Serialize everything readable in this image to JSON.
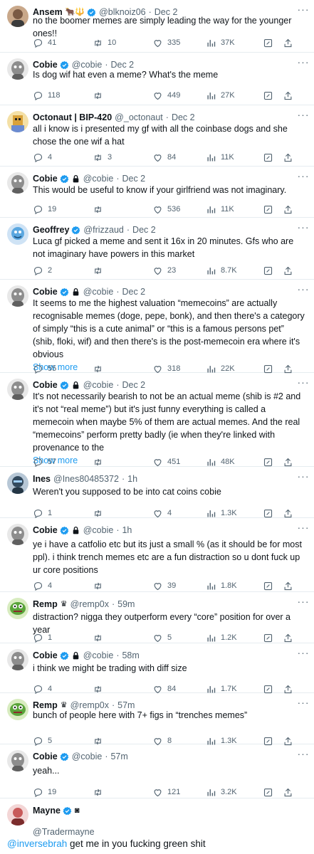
{
  "icons": {
    "reply": "reply-icon",
    "retweet": "retweet-icon",
    "like": "heart-icon",
    "views": "views-icon",
    "bookmark": "bookmark-icon",
    "share": "share-icon",
    "verified": "verified-badge-icon",
    "protected": "lock-icon",
    "more": "more-icon"
  },
  "colors": {
    "accent": "#1d9bf0",
    "muted": "#536471",
    "divider": "#e6ecf0"
  },
  "tweets": [
    {
      "name": "Ansem",
      "emoji": "🐂🔱",
      "handle": "@blknoiz06",
      "time": "Dec 2",
      "text": "no the boomer memes are simply leading the way for the younger ones!!",
      "replies": "41",
      "retweets": "10",
      "likes": "335",
      "views": "37K"
    },
    {
      "name": "Cobie",
      "handle": "@cobie",
      "time": "Dec 2",
      "text": "Is dog wif hat even a meme? What's the meme",
      "replies": "118",
      "retweets": "",
      "likes": "449",
      "views": "27K"
    },
    {
      "name": "Octonaut | BIP-420",
      "handle": "@_octonaut",
      "time": "Dec 2",
      "text": "all i know is i presented my gf with all the coinbase dogs and she chose the one wif a hat",
      "replies": "4",
      "retweets": "3",
      "likes": "84",
      "views": "11K"
    },
    {
      "name": "Cobie",
      "handle": "@cobie",
      "time": "Dec 2",
      "text": "This would be useful to know if your girlfriend was not imaginary.",
      "replies": "19",
      "retweets": "",
      "likes": "536",
      "views": "11K"
    },
    {
      "name": "Geoffrey",
      "handle": "@frizzaud",
      "time": "Dec 2",
      "text": "Luca gf picked a meme and sent it 16x in 20 minutes. Gfs who are not imaginary have powers in this market",
      "replies": "2",
      "retweets": "",
      "likes": "23",
      "views": "8.7K"
    },
    {
      "name": "Cobie",
      "handle": "@cobie",
      "time": "Dec 2",
      "text": "It seems to me the highest valuation “memecoins” are actually recognisable memes (doge, pepe, bonk), and then there's a category of simply “this is a cute animal” or “this is a famous persons pet” (shib, floki, wif) and then there's is the post-memecoin era where it's obvious",
      "show_more": "Show more",
      "replies": "55",
      "retweets": "",
      "likes": "318",
      "views": "22K"
    },
    {
      "name": "Cobie",
      "handle": "@cobie",
      "time": "Dec 2",
      "text": "It's not necessarily bearish to not be an actual meme (shib is #2 and it's not “real meme”) but it's just funny everything is called a memecoin when maybe 5% of them are actual memes. And the real “memecoins” perform pretty badly (ie when they're linked with provenance to the",
      "show_more": "Show more",
      "replies": "57",
      "retweets": "",
      "likes": "451",
      "views": "48K"
    },
    {
      "name": "Ines",
      "handle": "@Ines80485372",
      "time": "1h",
      "text": "Weren't you supposed to be into cat coins cobie",
      "replies": "1",
      "retweets": "",
      "likes": "4",
      "views": "1.3K"
    },
    {
      "name": "Cobie",
      "handle": "@cobie",
      "time": "1h",
      "text": "ye i have a catfolio etc but its just a small % (as it should be for most ppl). i think trench memes etc are a fun distraction so u dont fuck up ur core positions",
      "replies": "4",
      "retweets": "",
      "likes": "39",
      "views": "1.8K"
    },
    {
      "name": "Remp",
      "emoji": "♛",
      "handle": "@remp0x",
      "time": "59m",
      "text": "distraction? nigga they outperform every “core” position for over a year",
      "replies": "1",
      "retweets": "",
      "likes": "5",
      "views": "1.2K"
    },
    {
      "name": "Cobie",
      "handle": "@cobie",
      "time": "58m",
      "text": "i think we might be trading with diff size",
      "replies": "4",
      "retweets": "",
      "likes": "84",
      "views": "1.7K"
    },
    {
      "name": "Remp",
      "emoji": "♛",
      "handle": "@remp0x",
      "time": "57m",
      "text": "bunch of people here with 7+ figs in “trenches memes”",
      "replies": "5",
      "retweets": "",
      "likes": "8",
      "views": "1.3K"
    },
    {
      "name": "Cobie",
      "handle": "@cobie",
      "time": "57m",
      "text": "yeah...",
      "replies": "19",
      "retweets": "",
      "likes": "121",
      "views": "3.2K"
    }
  ],
  "last": {
    "name": "Mayne",
    "emoji": "◙",
    "handle": "@Tradermayne",
    "mention": "@inversebrah",
    "text": " get me in you fucking green shit"
  }
}
